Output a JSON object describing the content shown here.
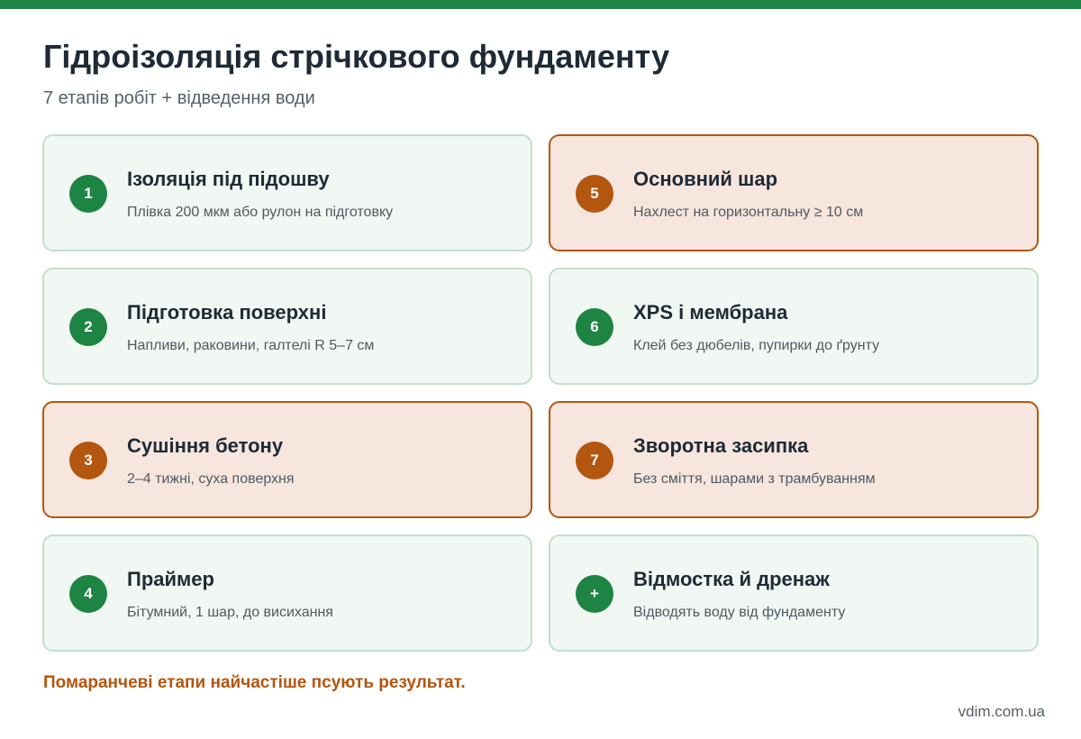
{
  "colors": {
    "accent_green": "#1d8443",
    "accent_orange": "#b3560f",
    "card_green_bg": "#f1f7f2",
    "card_orange_bg": "#f7e6de"
  },
  "header": {
    "title": "Гідроізоляція стрічкового фундаменту",
    "subtitle": "7 етапів робіт + відведення води"
  },
  "steps": [
    {
      "badge": "1",
      "title": "Ізоляція під підошву",
      "desc": "Плівка 200 мкм або рулон на підготовку",
      "critical": false
    },
    {
      "badge": "5",
      "title": "Основний шар",
      "desc": "Нахлест на горизонтальну ≥ 10 см",
      "critical": true
    },
    {
      "badge": "2",
      "title": "Підготовка поверхні",
      "desc": "Напливи, раковини, галтелі R 5–7 см",
      "critical": false
    },
    {
      "badge": "6",
      "title": "XPS і мембрана",
      "desc": "Клей без дюбелів, пупирки до ґрунту",
      "critical": false
    },
    {
      "badge": "3",
      "title": "Сушіння бетону",
      "desc": "2–4 тижні, суха поверхня",
      "critical": true
    },
    {
      "badge": "7",
      "title": "Зворотна засипка",
      "desc": "Без сміття, шарами з трамбуванням",
      "critical": true
    },
    {
      "badge": "4",
      "title": "Праймер",
      "desc": "Бітумний, 1 шар, до висихання",
      "critical": false
    },
    {
      "badge": "+",
      "title": "Відмостка й дренаж",
      "desc": "Відводять воду від фундаменту",
      "critical": false
    }
  ],
  "footer": {
    "note": "Помаранчеві етапи найчастіше псують результат.",
    "site": "vdim.com.ua"
  }
}
